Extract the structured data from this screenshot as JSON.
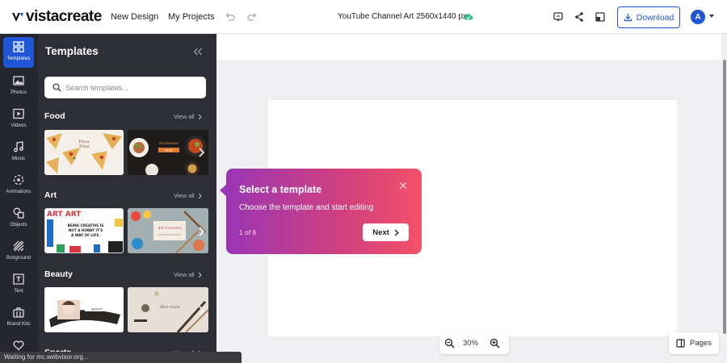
{
  "app": {
    "logo_text": "vistacreate",
    "brand_color": "#1e56d6"
  },
  "topbar": {
    "new_design": "New Design",
    "my_projects": "My Projects",
    "document_title": "YouTube Channel Art 2560x1440 px",
    "download_label": "Download",
    "avatar_letter": "A",
    "icons": [
      "undo-icon",
      "redo-icon",
      "cloud-saved-icon",
      "feedback-icon",
      "share-icon",
      "resize-icon",
      "download-icon",
      "caret-down-icon"
    ]
  },
  "rail": {
    "items": [
      {
        "label": "Templates",
        "icon": "templates-icon",
        "active": true
      },
      {
        "label": "Photos",
        "icon": "photo-icon"
      },
      {
        "label": "Videos",
        "icon": "video-icon"
      },
      {
        "label": "Music",
        "icon": "music-icon"
      },
      {
        "label": "Animations",
        "icon": "animations-icon"
      },
      {
        "label": "Objects",
        "icon": "objects-icon"
      },
      {
        "label": "Bckground",
        "icon": "background-icon"
      },
      {
        "label": "Text",
        "icon": "text-icon"
      },
      {
        "label": "Brand Kits",
        "icon": "brand-kit-icon"
      },
      {
        "label": "",
        "icon": "heart-icon"
      }
    ]
  },
  "panel": {
    "title": "Templates",
    "search_placeholder": "Search templates...",
    "view_all": "View all",
    "categories": [
      {
        "name": "Food"
      },
      {
        "name": "Art"
      },
      {
        "name": "Beauty"
      },
      {
        "name": "Sports"
      }
    ],
    "thumb_text": {
      "art_words": "ART ART",
      "art_quote": "BEING CREATIVE IS NOT A HOBBY IT'S A WAY OF LIFE."
    }
  },
  "tooltip": {
    "title": "Select a template",
    "body": "Choose the template and start editing",
    "step": "1 of 6",
    "next_label": "Next"
  },
  "zoom": {
    "value": "30%"
  },
  "pages": {
    "label": "Pages"
  },
  "status_bar": {
    "text": "Waiting for mc.webvisor.org..."
  }
}
